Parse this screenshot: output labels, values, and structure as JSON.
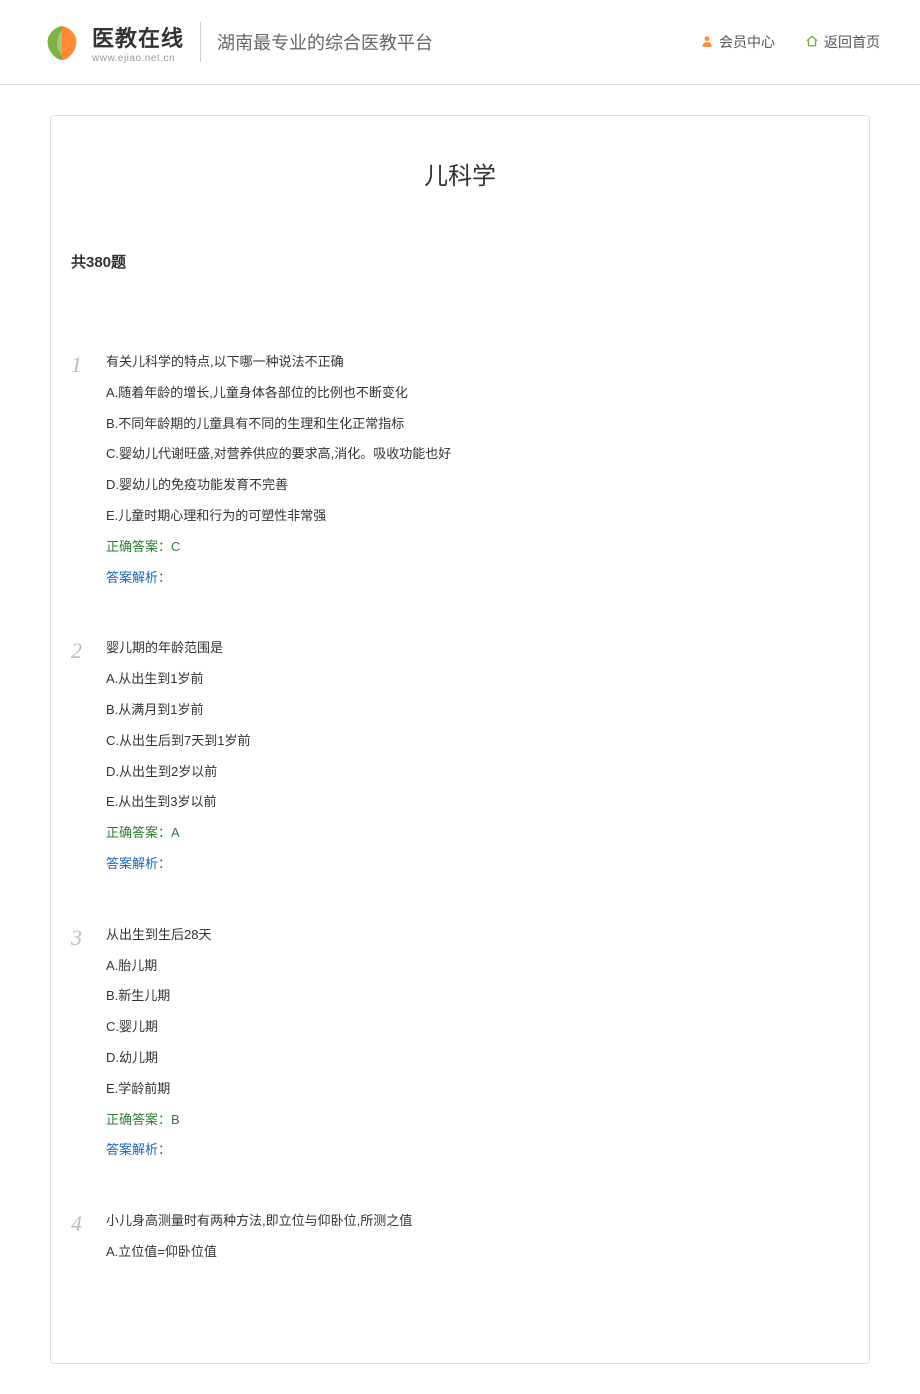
{
  "header": {
    "logo_title": "医教在线",
    "logo_url": "www.ejiao.net.cn",
    "tagline": "湖南最专业的综合医教平台",
    "nav": {
      "member_center": "会员中心",
      "home": "返回首页"
    }
  },
  "page": {
    "title": "儿科学",
    "count_label": "共380题"
  },
  "questions": [
    {
      "number": "1",
      "text": "有关儿科学的特点,以下哪一种说法不正确",
      "options": [
        "A.随着年龄的增长,儿童身体各部位的比例也不断变化",
        "B.不同年龄期的儿童具有不同的生理和生化正常指标",
        "C.婴幼儿代谢旺盛,对营养供应的要求高,消化。吸收功能也好",
        "D.婴幼儿的免疫功能发育不完善",
        "E.儿童时期心理和行为的可塑性非常强"
      ],
      "answer": "正确答案：C",
      "analysis": "答案解析："
    },
    {
      "number": "2",
      "text": "婴儿期的年龄范围是",
      "options": [
        "A.从出生到1岁前",
        "B.从满月到1岁前",
        "C.从出生后到7天到1岁前",
        "D.从出生到2岁以前",
        "E.从出生到3岁以前"
      ],
      "answer": "正确答案：A",
      "analysis": "答案解析："
    },
    {
      "number": "3",
      "text": "从出生到生后28天",
      "options": [
        "A.胎儿期",
        "B.新生儿期",
        "C.婴儿期",
        "D.幼儿期",
        "E.学龄前期"
      ],
      "answer": "正确答案：B",
      "analysis": "答案解析："
    },
    {
      "number": "4",
      "text": "小儿身高测量时有两种方法,即立位与仰卧位,所测之值",
      "options": [
        "A.立位值=仰卧位值"
      ],
      "answer": "",
      "analysis": ""
    }
  ]
}
